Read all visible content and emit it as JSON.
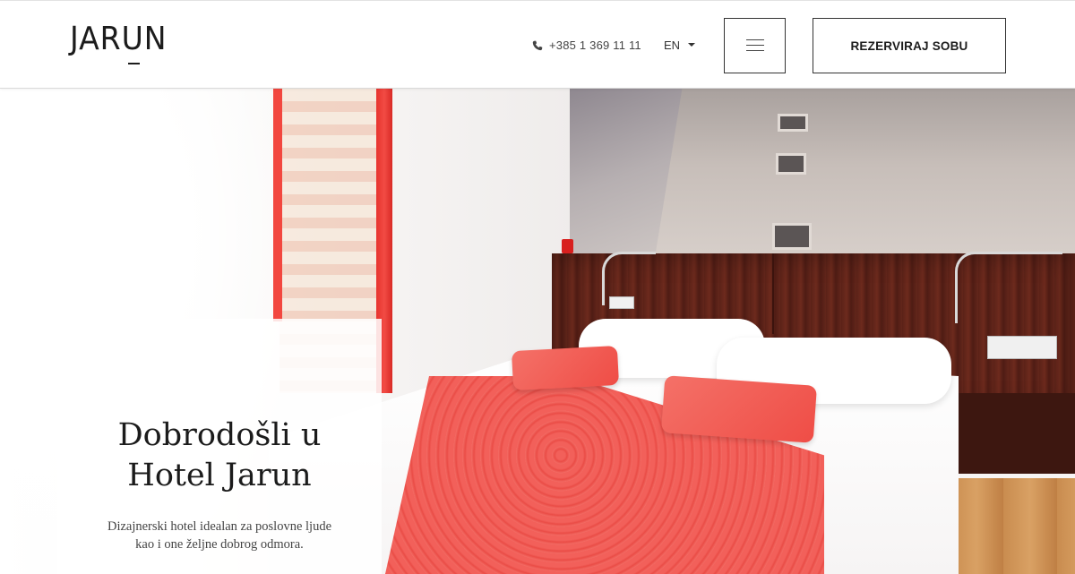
{
  "header": {
    "logo_text": "JARUN",
    "phone": "+385 1 369 11 11",
    "phone_icon": "phone-icon",
    "language": "EN",
    "language_icon": "caret-down-icon",
    "menu_icon": "hamburger-menu-icon",
    "reserve_label": "REZERVIRAJ SOBU"
  },
  "hero": {
    "image": "hotel-room-photo",
    "title_line1": "Dobrodošli u",
    "title_line2": "Hotel Jarun",
    "subtitle_line1": "Dizajnerski hotel idealan za poslovne ljude",
    "subtitle_line2": "kao i one željne dobrog odmora."
  },
  "colors": {
    "accent": "#ef4d46",
    "text": "#1b1b1b",
    "border": "#333333"
  }
}
